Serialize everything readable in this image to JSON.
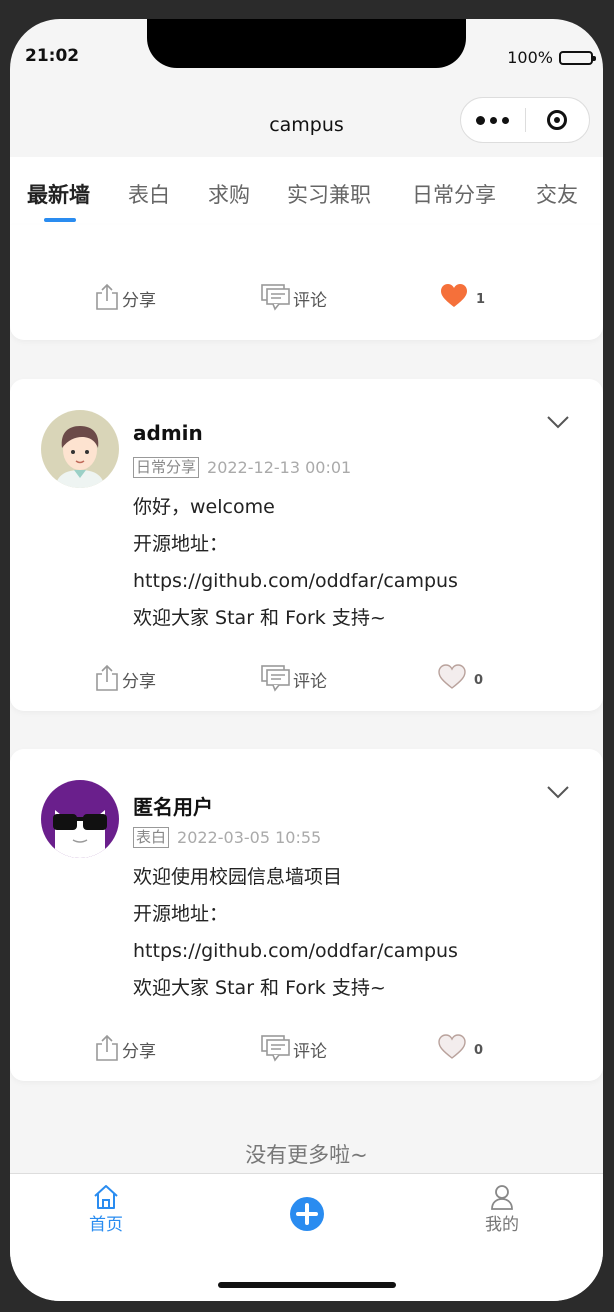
{
  "status": {
    "time": "21:02",
    "battery": "100%"
  },
  "navbar": {
    "title": "campus"
  },
  "tabs": [
    "最新墙",
    "表白",
    "求购",
    "实习兼职",
    "日常分享",
    "交友"
  ],
  "actions": {
    "share": "分享",
    "comment": "评论"
  },
  "partial_post": {
    "likes": "1"
  },
  "posts": [
    {
      "username": "admin",
      "category": "日常分享",
      "time": "2022-12-13 00:01",
      "lines": [
        "你好，welcome",
        "开源地址：",
        "https://github.com/oddfar/campus",
        "欢迎大家 Star 和 Fork 支持~"
      ],
      "likes": "0"
    },
    {
      "username": "匿名用户",
      "category": "表白",
      "time": "2022-03-05 10:55",
      "lines": [
        "欢迎使用校园信息墙项目",
        "开源地址：",
        "https://github.com/oddfar/campus",
        "欢迎大家 Star 和 Fork 支持~"
      ],
      "likes": "0"
    }
  ],
  "footer_text": "没有更多啦~",
  "tabbar": {
    "home": "首页",
    "mine": "我的"
  },
  "colors": {
    "accent": "#2a8cf0",
    "heart_active": "#f5703a",
    "background": "#f5f5f5"
  }
}
